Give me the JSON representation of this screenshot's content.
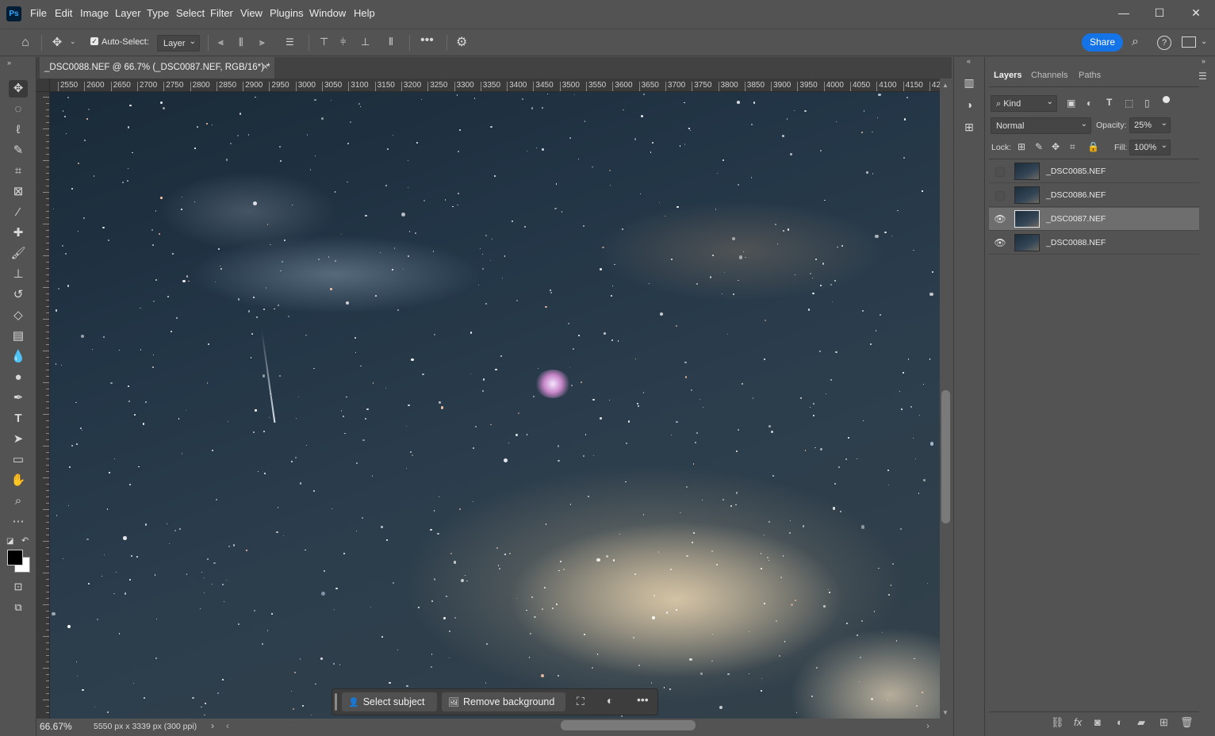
{
  "app": {
    "logo": "Ps"
  },
  "menu": [
    "File",
    "Edit",
    "Image",
    "Layer",
    "Type",
    "Select",
    "Filter",
    "View",
    "Plugins",
    "Window",
    "Help"
  ],
  "window_controls": {
    "minimize": "—",
    "maximize": "☐",
    "close": "✕"
  },
  "options_bar": {
    "auto_select_label": "Auto-Select:",
    "auto_select_checked": true,
    "target_value": "Layer",
    "share_label": "Share"
  },
  "document_tab": {
    "title": "_DSC0088.NEF @ 66.7% (_DSC0087.NEF, RGB/16*) *",
    "close": "×"
  },
  "ruler": {
    "h_ticks": [
      "2550",
      "2600",
      "2650",
      "2700",
      "2750",
      "2800",
      "2850",
      "2900",
      "2950",
      "3000",
      "3050",
      "3100",
      "3150",
      "3200",
      "3250",
      "3300",
      "3350",
      "3400",
      "3450",
      "3500",
      "3550",
      "3600",
      "3650",
      "3700",
      "3750",
      "3800",
      "3850",
      "3900",
      "3950",
      "4000",
      "4050",
      "4100",
      "4150",
      "42"
    ]
  },
  "taskbar": {
    "select_subject": "Select subject",
    "remove_background": "Remove background"
  },
  "status": {
    "zoom": "66.67%",
    "doc_info": "5550 px x 3339 px (300 ppi)"
  },
  "layers_panel": {
    "tabs": [
      "Layers",
      "Channels",
      "Paths"
    ],
    "active_tab": "Layers",
    "filter_kind": "Kind",
    "blend_mode": "Normal",
    "opacity_label": "Opacity:",
    "opacity_value": "25%",
    "lock_label": "Lock:",
    "fill_label": "Fill:",
    "fill_value": "100%",
    "layers": [
      {
        "name": "_DSC0085.NEF",
        "visible": false,
        "selected": false
      },
      {
        "name": "_DSC0086.NEF",
        "visible": false,
        "selected": false
      },
      {
        "name": "_DSC0087.NEF",
        "visible": true,
        "selected": true
      },
      {
        "name": "_DSC0088.NEF",
        "visible": true,
        "selected": false
      }
    ]
  },
  "colors": {
    "accent": "#1473e6",
    "panel_bg": "#535353",
    "selected_layer": "#6e6e6e"
  }
}
